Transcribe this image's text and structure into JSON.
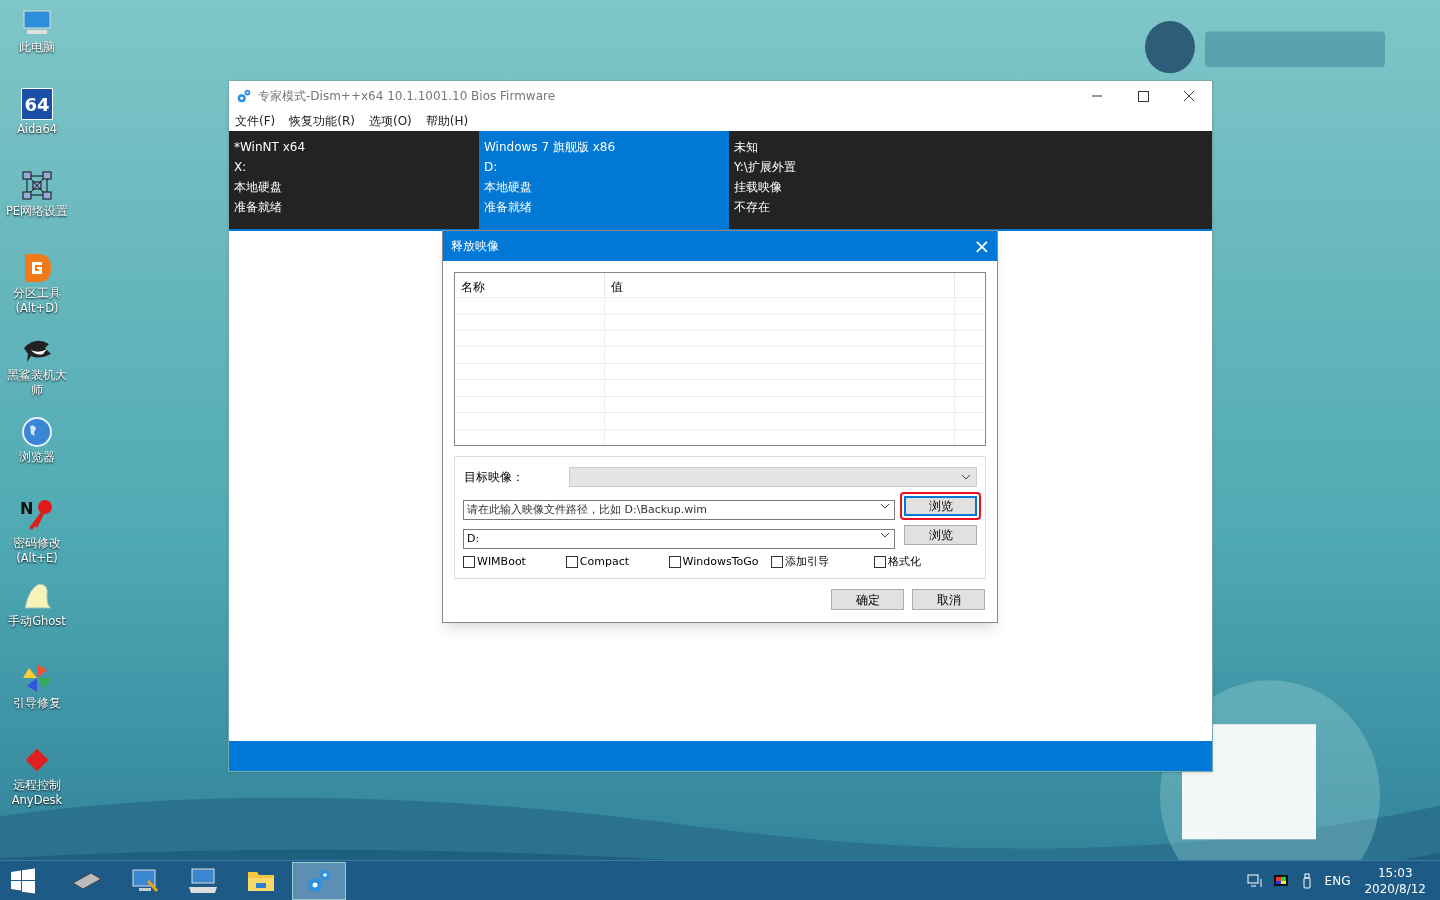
{
  "desktop_icons": [
    {
      "kind": "pc",
      "lines": [
        "此电脑"
      ]
    },
    {
      "kind": "aida",
      "lines": [
        "Aida64"
      ],
      "glyph": "64"
    },
    {
      "kind": "network",
      "lines": [
        "PE网络设置"
      ]
    },
    {
      "kind": "partition",
      "lines": [
        "分区工具",
        "(Alt+D)"
      ]
    },
    {
      "kind": "shark",
      "lines": [
        "黑鲨装机大",
        "师"
      ]
    },
    {
      "kind": "globe",
      "lines": [
        "浏览器"
      ]
    },
    {
      "kind": "key",
      "lines": [
        "密码修改",
        "(Alt+E)"
      ],
      "glyph": "N"
    },
    {
      "kind": "ghost",
      "lines": [
        "手动Ghost"
      ]
    },
    {
      "kind": "pinwheel",
      "lines": [
        "引导修复"
      ]
    },
    {
      "kind": "anydesk",
      "lines": [
        "远程控制",
        "AnyDesk"
      ]
    }
  ],
  "window": {
    "title": "专家模式-Dism++x64 10.1.1001.10 Bios Firmware",
    "menu": [
      "文件(F)",
      "恢复功能(R)",
      "选项(O)",
      "帮助(H)"
    ],
    "systems": [
      {
        "selected": false,
        "lines": [
          "*WinNT x64",
          "X:",
          "本地硬盘",
          "准备就绪"
        ]
      },
      {
        "selected": true,
        "lines": [
          "Windows 7 旗舰版 x86",
          "D:",
          "本地硬盘",
          "准备就绪"
        ]
      },
      {
        "selected": false,
        "lines": [
          "未知",
          "Y:\\扩展外置",
          "挂载映像",
          "不存在"
        ]
      }
    ]
  },
  "dialog": {
    "title": "释放映像",
    "close": "×",
    "table": {
      "columns": [
        "名称",
        "值"
      ]
    },
    "target_label": "目标映像：",
    "image_path": {
      "placeholder": "请在此输入映像文件路径，比如 D:\\Backup.wim"
    },
    "browse_1": {
      "label": "浏览",
      "highlighted": true
    },
    "drive": {
      "value": "D:"
    },
    "browse_2": {
      "label": "浏览",
      "highlighted": false
    },
    "options": [
      {
        "label": "WIMBoot",
        "checked": false
      },
      {
        "label": "Compact",
        "checked": false
      },
      {
        "label": "WindowsToGo",
        "checked": false
      },
      {
        "label": "添加引导",
        "checked": false
      },
      {
        "label": "格式化",
        "checked": false
      }
    ],
    "buttons": [
      "确定",
      "取消"
    ]
  },
  "taskbar": {
    "items": [
      {
        "kind": "chip",
        "selected": false
      },
      {
        "kind": "monitor",
        "selected": false
      },
      {
        "kind": "keyboard",
        "selected": false
      },
      {
        "kind": "folder",
        "selected": false
      },
      {
        "kind": "gears",
        "selected": true
      }
    ],
    "language": "ENG",
    "time": "15:03",
    "date": "2020/8/12"
  }
}
